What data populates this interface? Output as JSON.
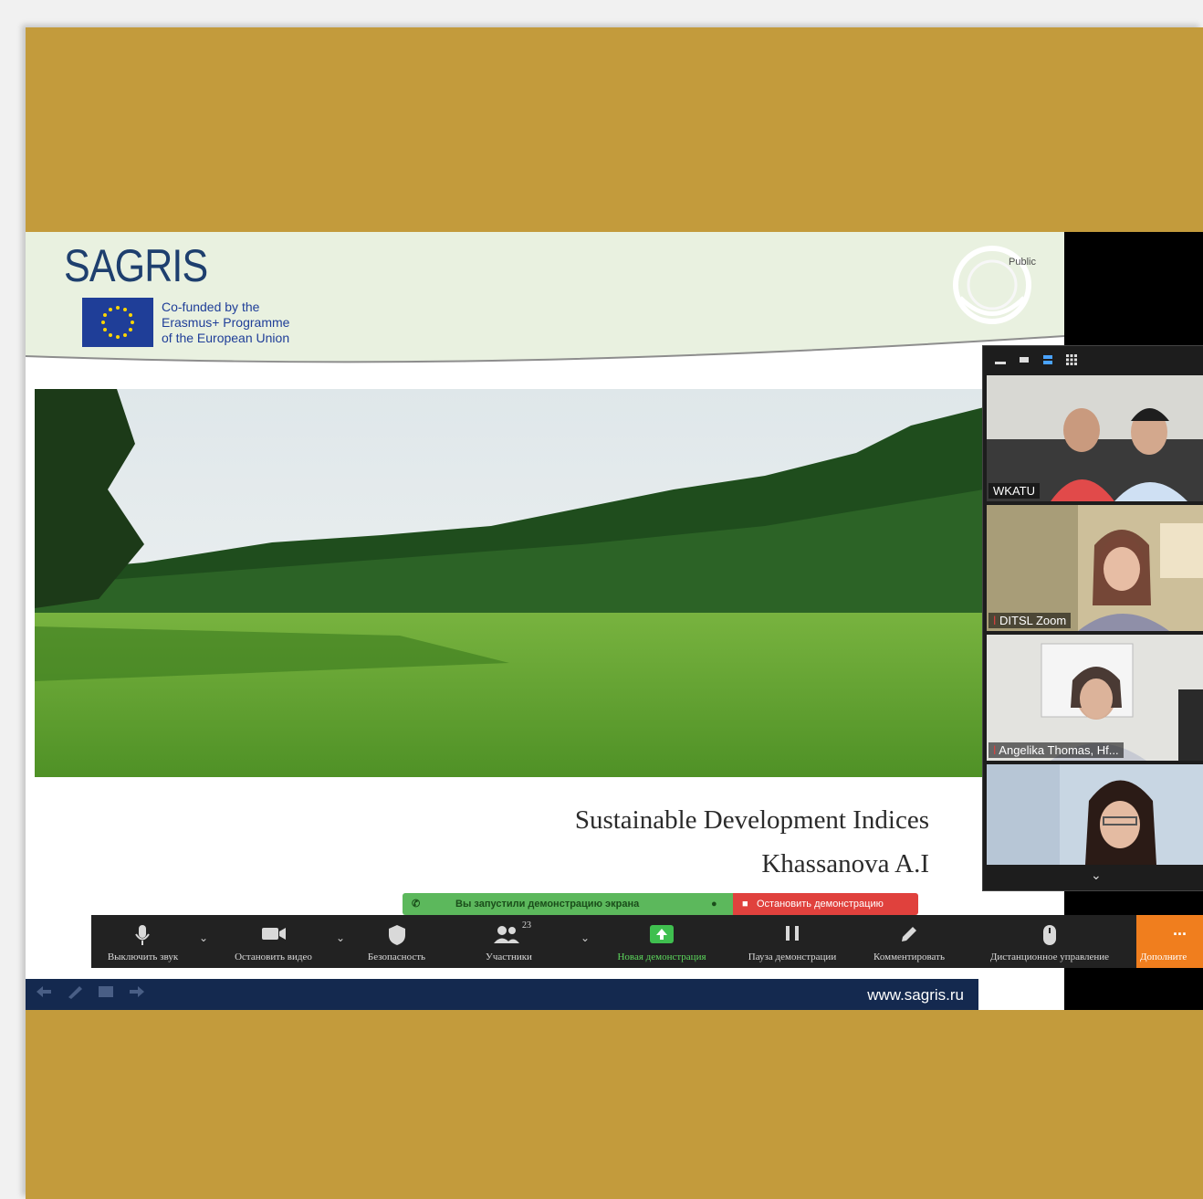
{
  "slide": {
    "logo_text": "SAGRIS",
    "eu_text": [
      "Co-funded by the",
      "Erasmus+ Programme",
      "of the European Union"
    ],
    "public_label": "Public",
    "title": "Sustainable Development  Indices",
    "author": "Khassanova A.I",
    "footer_url": "www.sagris.ru"
  },
  "share_banner": {
    "message": "Вы запустили демонстрацию экрана",
    "stop_label": "Остановить демонстрацию"
  },
  "gallery": {
    "participants": [
      {
        "name": "WKATU"
      },
      {
        "name": "DITSL Zoom"
      },
      {
        "name": "Angelika Thomas, Hf..."
      },
      {
        "name": ""
      }
    ]
  },
  "toolbar": {
    "mute_label": "Выключить звук",
    "video_label": "Остановить видео",
    "security_label": "Безопасность",
    "participants_label": "Участники",
    "participants_count": "23",
    "new_share_label": "Новая демонстрация",
    "pause_share_label": "Пауза демонстрации",
    "annotate_label": "Комментировать",
    "remote_control_label": "Дистанционное управление",
    "more_label": "Дополните",
    "more_glyph": "...",
    "accent_color": "#f07e1e",
    "share_green": "#5cb85c",
    "stop_red": "#e0413d"
  }
}
